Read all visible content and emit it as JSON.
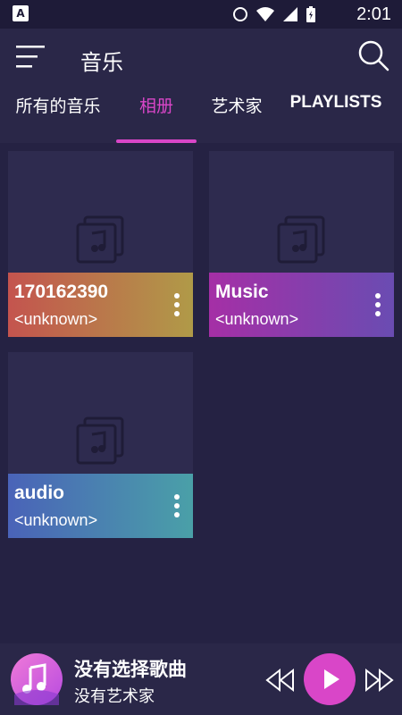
{
  "status_bar": {
    "time": "2:01"
  },
  "app_bar": {
    "title": "音乐"
  },
  "tabs": [
    {
      "label": "所有的音乐"
    },
    {
      "label": "相册"
    },
    {
      "label": "艺术家"
    },
    {
      "label": "PLAYLISTS"
    }
  ],
  "active_tab_index": 1,
  "albums": [
    {
      "name": "170162390",
      "artist": "<unknown>",
      "gradient": [
        "#c4544e",
        "#b09a48"
      ]
    },
    {
      "name": "Music",
      "artist": "<unknown>",
      "gradient": [
        "#a52fa6",
        "#6a4cb2"
      ]
    },
    {
      "name": "audio",
      "artist": "<unknown>",
      "gradient": [
        "#4a63b8",
        "#4aa0a8"
      ]
    }
  ],
  "player": {
    "title": "没有选择歌曲",
    "artist": "没有艺术家"
  },
  "colors": {
    "accent": "#d946c8",
    "background": "#252243",
    "card": "#2e2b4f"
  },
  "icons": [
    "menu-icon",
    "search-icon",
    "music-note-icon",
    "more-vert-icon",
    "skip-previous-icon",
    "play-icon",
    "skip-next-icon"
  ]
}
